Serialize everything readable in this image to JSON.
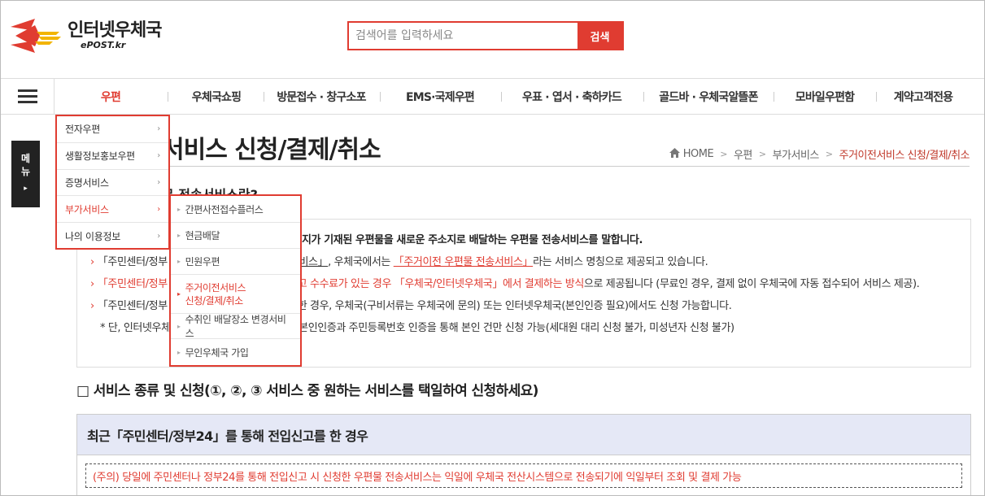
{
  "logo": {
    "title": "인터넷우체국",
    "sub": "ePOST.kr"
  },
  "search": {
    "placeholder": "검색어를 입력하세요",
    "button": "검색"
  },
  "gnb": {
    "items": [
      "우편",
      "우체국쇼핑",
      "방문접수 · 창구소포",
      "EMS·국제우편",
      "우표 · 엽서 · 축하카드",
      "골드바 · 우체국알뜰폰",
      "모바일우편함",
      "계약고객전용"
    ]
  },
  "side_tab": {
    "line1": "메",
    "line2": "뉴",
    "arrow": "▸"
  },
  "page": {
    "title": "서비스 신청/결제/취소",
    "breadcrumb": [
      "HOME",
      "우편",
      "부가서비스",
      "주거이전서비스 신청/결제/취소"
    ],
    "section_head": "무 전송서비스란?",
    "intro": {
      "line1": "지가 기재된 우편물을 새로운 주소지로 배달하는 우편물 전송서비스를 말합니다.",
      "line2_a": "「주민센터/정부",
      "line2_b": "전송서비스」",
      "line2_c": ", 우체국에서는 ",
      "line2_d": "「주거이전 우편물 전송서비스」",
      "line2_e": "라는 서비스 명칭으로 제공되고 있습니다.",
      "line3_a": "「주민센터/정부",
      "line3_b": "고 수수료가 있는 경우 「우체국/인터넷우체국」에서 결제하는 방식",
      "line3_c": "으로 제공됩니다 (무료인 경우, 결제 없이 우체국에 자동 접수되어 서비스 제공).",
      "line4_a": "「주민센터/정부",
      "line4_b": "한 경우, 우체국(구비서류는 우체국에 문의) 또는 인터넷우체국(본인인증 필요)에서도 신청 가능합니다.",
      "line5_a": "* 단, 인터넷우체",
      "line5_b": "· 본인인증과 주민등록번호 인증을 통해 본인 건만 신청 가능(세대원 대리 신청 불가, 미성년자 신청 불가)"
    },
    "service_title": "□ 서비스 종류 및 신청(①, ②, ③ 서비스 중 원하는 서비스를 택일하여 신청하세요)",
    "panel_head": "최근「주민센터/정부24」를 통해 전입신고를 한 경우",
    "notice": "(주의) 당일에 주민센터나 정부24를 통해 전입신고 시 신청한 우편물 전송서비스는 익일에 우체국 전산시스템으로 전송되기에 익일부터 조회 및 결제 가능"
  },
  "dropdown1": {
    "items": [
      "전자우편",
      "생활정보홍보우편",
      "증명서비스",
      "부가서비스",
      "나의 이용정보"
    ],
    "chevron": "›"
  },
  "dropdown2": {
    "items": [
      "간편사전접수플러스",
      "현금배달",
      "민원우편",
      "주거이전서비스",
      "신청/결제/취소",
      "수취인 배달장소 변경서비스",
      "무인우체국 가입"
    ],
    "tri": "▸"
  },
  "colors": {
    "accent": "#e03c31",
    "panel_head_bg": "#e5e8f6",
    "side_tab_bg": "#222222"
  },
  "icons": {
    "home": "home-icon",
    "menu": "hamburger-icon",
    "logo": "epost-logo-icon"
  }
}
